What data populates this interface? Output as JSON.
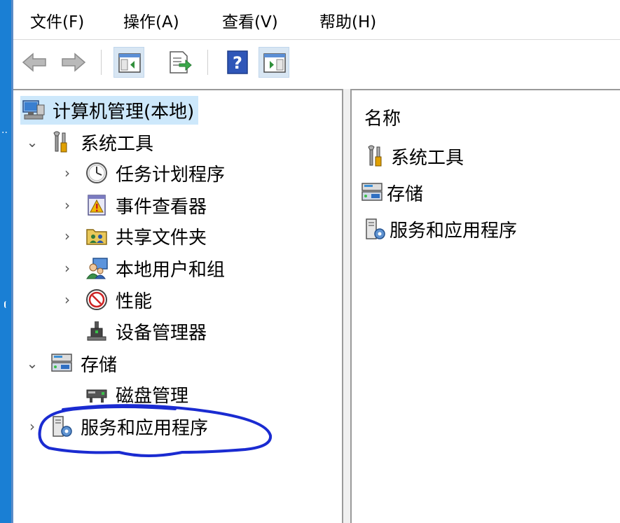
{
  "menu": [
    "文件(F)",
    "操作(A)",
    "查看(V)",
    "帮助(H)"
  ],
  "toolbar": {
    "buttons": [
      "back-icon",
      "forward-icon",
      "show-hide-console-tree-icon",
      "export-list-icon",
      "help-icon",
      "show-hide-action-pane-icon"
    ]
  },
  "tree": {
    "root": "计算机管理(本地)",
    "system_tools": "系统工具",
    "task_scheduler": "任务计划程序",
    "event_viewer": "事件查看器",
    "shared_folders": "共享文件夹",
    "local_users": "本地用户和组",
    "performance": "性能",
    "device_manager": "设备管理器",
    "storage": "存储",
    "disk_management": "磁盘管理",
    "services_apps": "服务和应用程序"
  },
  "list": {
    "header": "名称",
    "rows": [
      "系统工具",
      "存储",
      "服务和应用程序"
    ]
  },
  "colors": {
    "annotation": "#1a2bd1",
    "selection": "#cde8fb",
    "desktop": "#1a7fd4"
  }
}
